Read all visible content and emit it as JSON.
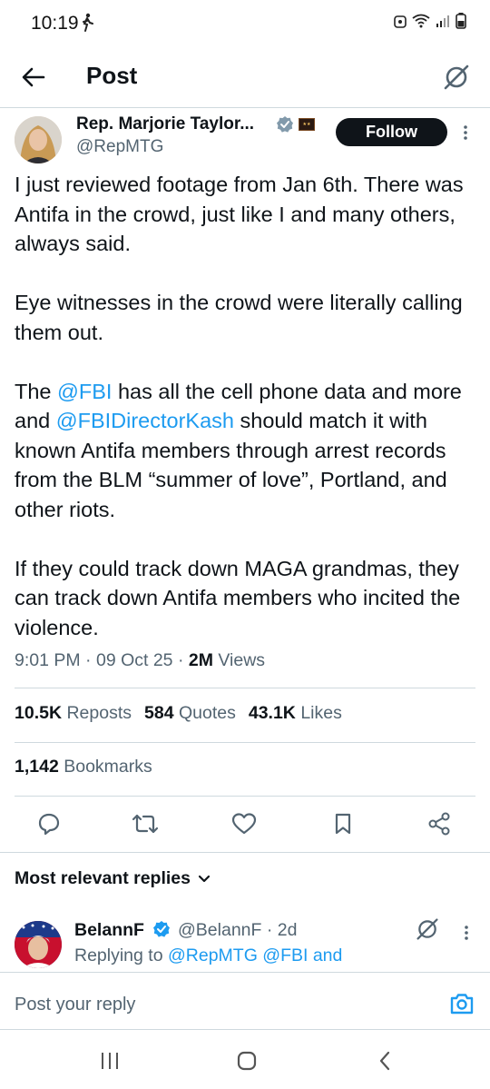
{
  "status_bar": {
    "time": "10:19",
    "walk_icon": "walking-person-icon",
    "icons": [
      "alarm-icon",
      "wifi-icon",
      "signal-icon",
      "battery-icon"
    ]
  },
  "header": {
    "back_icon": "arrow-left-icon",
    "title": "Post",
    "grok_icon": "grok-icon"
  },
  "post": {
    "author": {
      "name": "Rep. Marjorie Taylor...",
      "handle": "@RepMTG",
      "verified": "gray-verified-badge",
      "affiliate_badge": "flag-badge"
    },
    "follow_label": "Follow",
    "paragraphs": [
      {
        "segments": [
          {
            "text": "I just reviewed footage from Jan 6th. There was Antifa in the crowd, just like I and many others, always said.",
            "mention": false
          }
        ]
      },
      {
        "segments": [
          {
            "text": "Eye witnesses in the crowd were literally calling them out.",
            "mention": false
          }
        ]
      },
      {
        "segments": [
          {
            "text": "The ",
            "mention": false
          },
          {
            "text": "@FBI",
            "mention": true
          },
          {
            "text": " has all the cell phone data and more and ",
            "mention": false
          },
          {
            "text": "@FBIDirectorKash",
            "mention": true
          },
          {
            "text": " should match it with known Antifa members through arrest records from the BLM “summer of love”, Portland, and other riots.",
            "mention": false
          }
        ]
      },
      {
        "segments": [
          {
            "text": "If they could track down MAGA grandmas, they can track down Antifa members who incited the violence.",
            "mention": false
          }
        ]
      }
    ],
    "time": "9:01 PM",
    "date": "09 Oct 25",
    "sep": "·",
    "views_count": "2M",
    "views_label": "Views",
    "stats": {
      "reposts_count": "10.5K",
      "reposts_label": "Reposts",
      "quotes_count": "584",
      "quotes_label": "Quotes",
      "likes_count": "43.1K",
      "likes_label": "Likes",
      "bookmarks_count": "1,142",
      "bookmarks_label": "Bookmarks"
    },
    "actions": [
      "reply-icon",
      "repost-icon",
      "like-icon",
      "bookmark-icon",
      "share-icon"
    ]
  },
  "replies": {
    "sort_label": "Most relevant replies",
    "items": [
      {
        "name": "BelannF",
        "handle": "@BelannF",
        "age": "2d",
        "replying_prefix": "Replying to",
        "replying_to": "@RepMTG @FBI and"
      }
    ]
  },
  "compose": {
    "placeholder": "Post your reply",
    "camera_icon": "camera-icon"
  },
  "colors": {
    "text": "#0f1419",
    "secondary": "#536471",
    "accent": "#1d9bf0",
    "divider": "#cfd9de"
  }
}
